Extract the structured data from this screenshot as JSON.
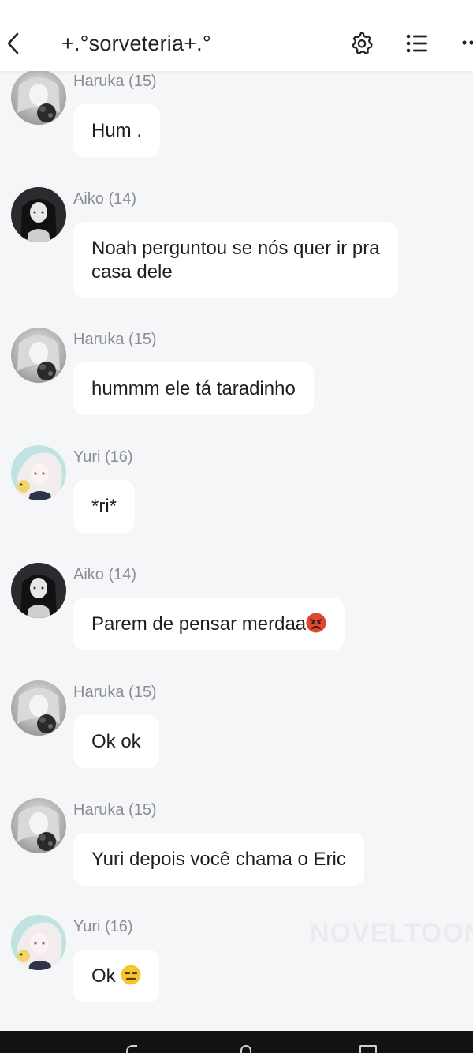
{
  "header": {
    "title": "+.°sorveteria+.°"
  },
  "icons": {
    "back": "chevron-left-icon",
    "settings": "gear-icon",
    "list": "list-icon",
    "more": "more-icon"
  },
  "messages": [
    {
      "sender": "Haruka (15)",
      "text": "Hum .",
      "avatar": "haruka"
    },
    {
      "sender": "Aiko (14)",
      "text": "Noah perguntou se nós quer ir pra\ncasa dele",
      "avatar": "aiko"
    },
    {
      "sender": "Haruka (15)",
      "text": "hummm ele tá taradinho",
      "avatar": "haruka"
    },
    {
      "sender": "Yuri (16)",
      "text": "*ri*",
      "avatar": "yuri"
    },
    {
      "sender": "Aiko (14)",
      "text": "Parem de pensar merdaa",
      "emoji": "angry-face-emoji",
      "avatar": "aiko"
    },
    {
      "sender": "Haruka (15)",
      "text": "Ok ok",
      "avatar": "haruka"
    },
    {
      "sender": "Haruka (15)",
      "text": "Yuri depois você chama o Eric",
      "avatar": "haruka"
    },
    {
      "sender": "Yuri (16)",
      "text": "Ok ",
      "emoji": "expressionless-face-emoji",
      "avatar": "yuri"
    }
  ],
  "watermark": "NOVELTOON",
  "colors": {
    "background": "#f5f6f8",
    "bubble": "#ffffff",
    "sender_name": "#8a8d93",
    "angry_emoji": "#e0452e",
    "neutral_emoji": "#f7c531"
  }
}
